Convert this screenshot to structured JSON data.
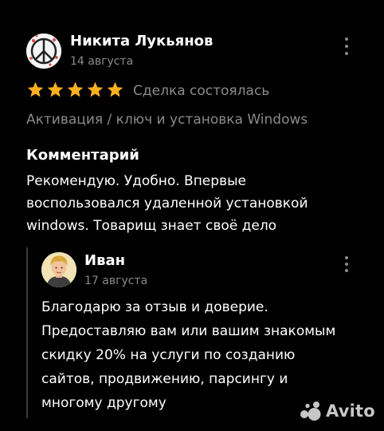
{
  "review": {
    "author_name": "Никита Лукьянов",
    "date": "14 августа",
    "rating": 5,
    "rating_max": 5,
    "star_color": "#ffb021",
    "deal_status": "Сделка состоялась",
    "category": "Активация / ключ и установка Windows",
    "comment_heading": "Комментарий",
    "comment_text": "Рекомендую. Удобно. Впервые воспользовался удаленной установкой windows. Товарищ знает своё дело"
  },
  "reply": {
    "author_name": "Иван",
    "date": "17 августа",
    "text": "Благодарю за отзыв и доверие. Предоставляю вам или вашим знакомым скидку 20% на услуги по созданию сайтов, продвижению, парсингу и многому другому"
  },
  "icons": {
    "menu": "kebab-menu-icon",
    "star": "star-icon",
    "logo": "avito-logo-icon"
  },
  "watermark": {
    "brand": "Avito"
  },
  "colors": {
    "background": "#000000",
    "text": "#ffffff",
    "secondary_text": "#8a8a8a",
    "star": "#ffb021"
  }
}
